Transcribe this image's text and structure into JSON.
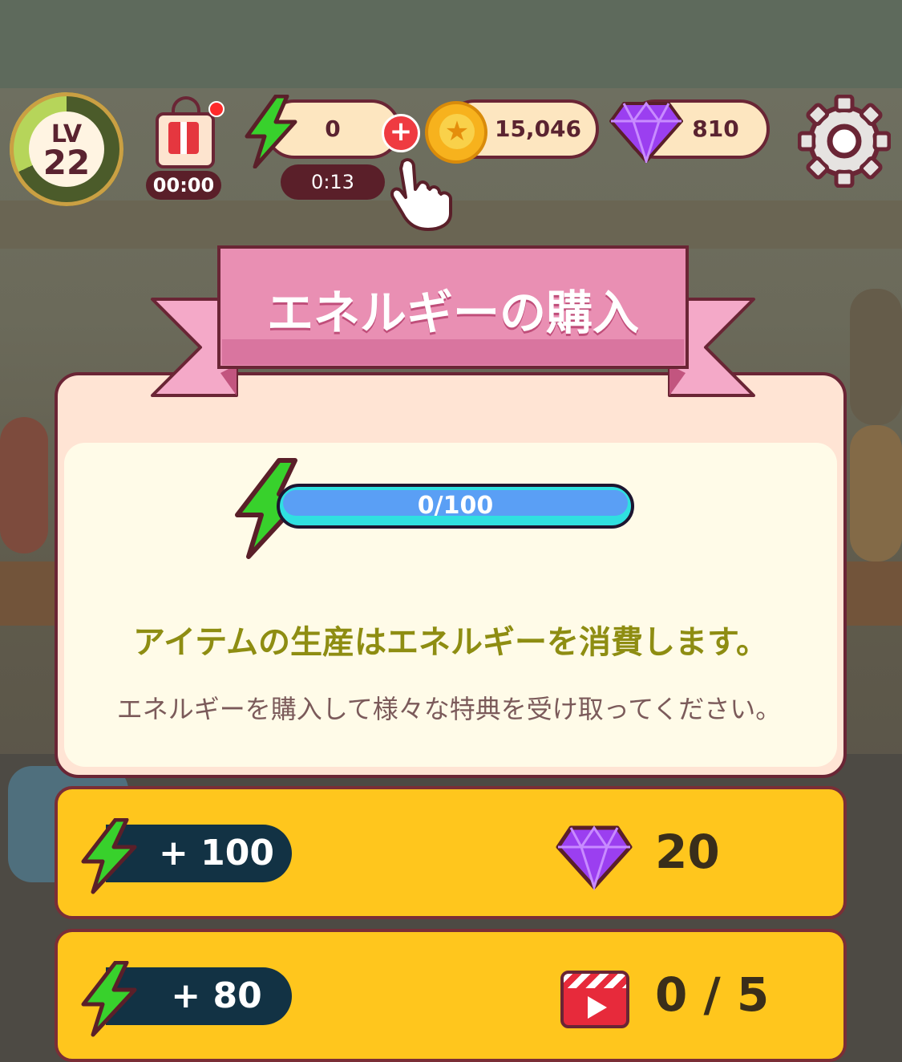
{
  "hud": {
    "level_prefix": "LV",
    "level_value": "22",
    "gift_timer": "00:00",
    "energy_value": "0",
    "energy_timer": "0:13",
    "coins": "15,046",
    "gems": "810"
  },
  "modal": {
    "title": "エネルギーの購入",
    "energy_bar": {
      "text": "0/100",
      "current": 0,
      "max": 100
    },
    "description_main": "アイテムの生産はエネルギーを消費します。",
    "description_sub": "エネルギーを購入して様々な特典を受け取ってください。"
  },
  "offers": [
    {
      "amount": "+ 100",
      "cost": "20",
      "cost_icon": "gem-icon"
    },
    {
      "amount": "+ 80",
      "cost": "0 / 5",
      "cost_icon": "video-icon"
    }
  ],
  "colors": {
    "energy_green": "#38d12c",
    "offer_yellow": "#ffc61d",
    "ribbon_pink": "#e98fb3",
    "outline": "#6a2535"
  }
}
